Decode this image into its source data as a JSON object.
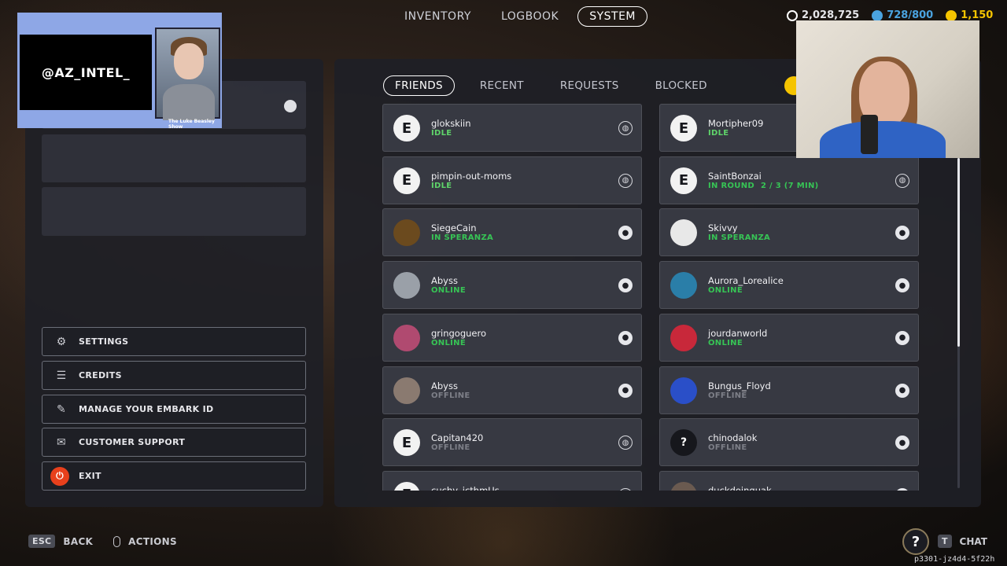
{
  "nav": {
    "tabs": [
      "INVENTORY",
      "LOGBOOK",
      "SYSTEM"
    ],
    "active": "SYSTEM"
  },
  "currency": {
    "coins": "2,028,725",
    "slots": "728/800",
    "tokens": "1,150",
    "colors": {
      "coins": "#ffffff",
      "slots": "#4aa3e0",
      "tokens": "#f5c400"
    }
  },
  "left_menu": [
    {
      "label": "SETTINGS",
      "icon": "gear-icon"
    },
    {
      "label": "CREDITS",
      "icon": "credits-icon"
    },
    {
      "label": "MANAGE YOUR EMBARK ID",
      "icon": "embark-id-icon"
    },
    {
      "label": "CUSTOMER SUPPORT",
      "icon": "support-icon"
    },
    {
      "label": "EXIT",
      "icon": "power-icon"
    }
  ],
  "subtabs": [
    "FRIENDS",
    "RECENT",
    "REQUESTS",
    "BLOCKED"
  ],
  "active_subtab": "FRIENDS",
  "friends": [
    {
      "name": "glokskiin",
      "status": "IDLE",
      "status_type": "idle",
      "platform": "globe",
      "avatar": "embark"
    },
    {
      "name": "Mortipher09",
      "status": "IDLE",
      "status_type": "idle",
      "platform": "globe",
      "avatar": "embark"
    },
    {
      "name": "pimpin-out-moms",
      "status": "IDLE",
      "status_type": "idle",
      "platform": "globe",
      "avatar": "embark"
    },
    {
      "name": "SaintBonzai",
      "status": "IN ROUND",
      "status_extra": "2 / 3 (7 MIN)",
      "status_type": "round",
      "platform": "globe",
      "avatar": "embark"
    },
    {
      "name": "SiegeCain",
      "status": "IN SPERANZA",
      "status_type": "speranza",
      "platform": "steam",
      "avatar": "badge"
    },
    {
      "name": "Skivvy",
      "status": "IN SPERANZA",
      "status_type": "speranza",
      "platform": "steam",
      "avatar": "pattern"
    },
    {
      "name": "Abyss",
      "status": "ONLINE",
      "status_type": "online",
      "platform": "steam",
      "avatar": "knight"
    },
    {
      "name": "Aurora_Lorealice",
      "status": "ONLINE",
      "status_type": "online",
      "platform": "steam",
      "avatar": "cube"
    },
    {
      "name": "gringoguero",
      "status": "ONLINE",
      "status_type": "online",
      "platform": "steam",
      "avatar": "bear"
    },
    {
      "name": "jourdanworld",
      "status": "ONLINE",
      "status_type": "online",
      "platform": "steam",
      "avatar": "red"
    },
    {
      "name": "Abyss",
      "status": "OFFLINE",
      "status_type": "offline",
      "platform": "steam",
      "avatar": "wolf"
    },
    {
      "name": "Bungus_Floyd",
      "status": "OFFLINE",
      "status_type": "offline",
      "platform": "steam",
      "avatar": "sonic"
    },
    {
      "name": "Capitan420",
      "status": "OFFLINE",
      "status_type": "offline",
      "platform": "globe",
      "avatar": "embark"
    },
    {
      "name": "chinodalok",
      "status": "OFFLINE",
      "status_type": "offline",
      "platform": "steam",
      "avatar": "question"
    },
    {
      "name": "cuchy_icthmUs",
      "status": "",
      "status_type": "offline",
      "platform": "globe",
      "avatar": "embark"
    },
    {
      "name": "duckdoinquak",
      "status": "",
      "status_type": "offline",
      "platform": "steam",
      "avatar": "duck"
    }
  ],
  "bottom": {
    "back_key": "ESC",
    "back_label": "BACK",
    "actions_label": "ACTIONS",
    "chat_key": "T",
    "chat_label": "CHAT",
    "build": "p3301-jz4d4-5f22h"
  },
  "overlay": {
    "streamer_text": "@AZ_INTEL_",
    "show_caption": "The Luke Beasley Show"
  }
}
